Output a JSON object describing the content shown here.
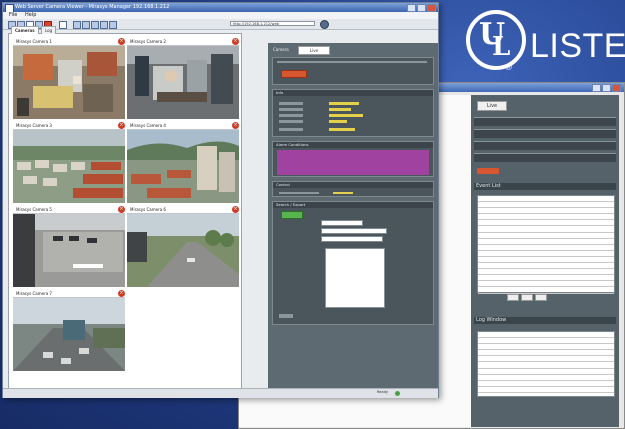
{
  "badge": {
    "brand": "UL",
    "listed": "LISTED",
    "reg": "®"
  },
  "main_window": {
    "title": "Web Server Camera Viewer - Mirasys Manager 192.168.1.212",
    "menu": [
      "File",
      "Help"
    ],
    "address": "http://192.168.1.212/web",
    "status": "Ready"
  },
  "camera_tabs": [
    "Cameras",
    "Log"
  ],
  "cameras": [
    {
      "label": "Mirasys Camera 1",
      "scene": "warehouse"
    },
    {
      "label": "Mirasys Camera 2",
      "scene": "office"
    },
    {
      "label": "Mirasys Camera 3",
      "scene": "housing"
    },
    {
      "label": "Mirasys Camera 4",
      "scene": "city"
    },
    {
      "label": "Mirasys Camera 5",
      "scene": "parking"
    },
    {
      "label": "Mirasys Camera 6",
      "scene": "road"
    },
    {
      "label": "Mirasys Camera 7",
      "scene": "traffic"
    }
  ],
  "dark_panel": {
    "tab_label": "Camera",
    "tab": "Live",
    "sections": [
      "Info",
      "Alarm Conditions",
      "Control",
      "Search / Export"
    ]
  },
  "back_window": {
    "tab": "Live",
    "list_header": "Event List",
    "table2_header": "Log Window"
  },
  "colors": {
    "accent_orange": "#d8562f",
    "panel_dark": "#5e6a71",
    "alarm_magenta": "#a0429f",
    "ok_green": "#57b44e",
    "title_blue": "#3a63b0"
  }
}
